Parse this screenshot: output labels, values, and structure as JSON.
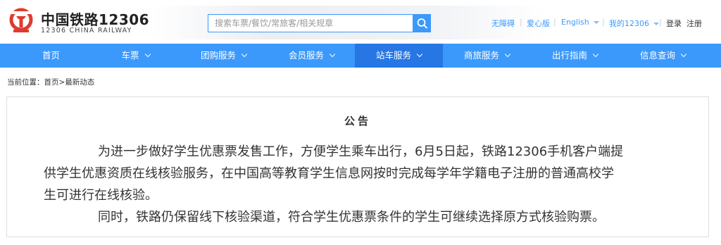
{
  "brand": {
    "name_cn": "中国铁路12306",
    "name_en": "12306 CHINA RAILWAY",
    "logo_icon": "china-railway-logo-icon",
    "logo_color": "#e03a2e"
  },
  "search": {
    "placeholder": "搜索车票/餐饮/常旅客/相关规章",
    "button_icon": "search-icon"
  },
  "top_links": {
    "accessibility": "无障碍",
    "care": "爱心版",
    "language": "English",
    "my_account": "我的12306",
    "login": "登录",
    "register": "注册"
  },
  "nav": {
    "items": [
      {
        "label": "首页",
        "has_dropdown": false
      },
      {
        "label": "车票",
        "has_dropdown": true
      },
      {
        "label": "团购服务",
        "has_dropdown": true
      },
      {
        "label": "会员服务",
        "has_dropdown": true
      },
      {
        "label": "站车服务",
        "has_dropdown": true,
        "active": true
      },
      {
        "label": "商旅服务",
        "has_dropdown": true
      },
      {
        "label": "出行指南",
        "has_dropdown": true
      },
      {
        "label": "信息查询",
        "has_dropdown": true
      }
    ]
  },
  "breadcrumb": {
    "prefix": "当前位置：",
    "home": "首页",
    "separator": ">",
    "current": "最新动态"
  },
  "notice": {
    "title": "公告",
    "paragraphs": [
      "为进一步做好学生优惠票发售工作，方便学生乘车出行，6月5日起，铁路12306手机客户端提",
      "供学生优惠资质在线核验服务，在中国高等教育学生信息网按时完成每学年学籍电子注册的普通高校学",
      "生可进行在线核验。",
      "同时，铁路仍保留线下核验渠道，符合学生优惠票条件的学生可继续选择原方式核验购票。"
    ]
  },
  "colors": {
    "accent": "#3b99fc",
    "nav_active": "#2676e3",
    "brand_red": "#e03a2e"
  }
}
